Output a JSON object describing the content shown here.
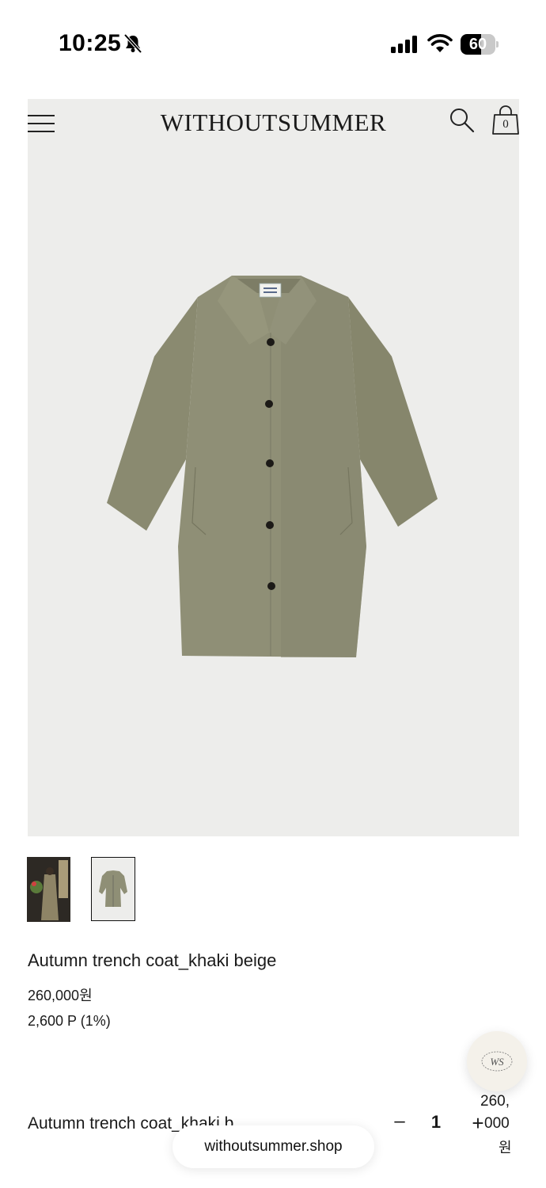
{
  "status_bar": {
    "time": "10:25",
    "battery_level": 60,
    "battery_text": "60"
  },
  "header": {
    "brand": "WITHOUTSUMMER",
    "cart_count": "0"
  },
  "icons": {
    "menu": "hamburger-menu-icon",
    "search": "search-icon",
    "bag": "shopping-bag-icon",
    "bell": "bell-slash-icon"
  },
  "product": {
    "name": "Autumn trench coat_khaki beige",
    "price": "260,000원",
    "points": "2,600 P (1%)",
    "color": "#8f8f76"
  },
  "order": {
    "item_name": "Autumn trench coat_khaki b",
    "minus": "–",
    "quantity": "1",
    "plus": "+",
    "price_line1": "260,",
    "price_line2": "000",
    "price_line3": "원"
  },
  "browser": {
    "url": "withoutsummer.shop"
  },
  "colors": {
    "hero_background": "#ededeb",
    "text": "#1a1a1a"
  }
}
